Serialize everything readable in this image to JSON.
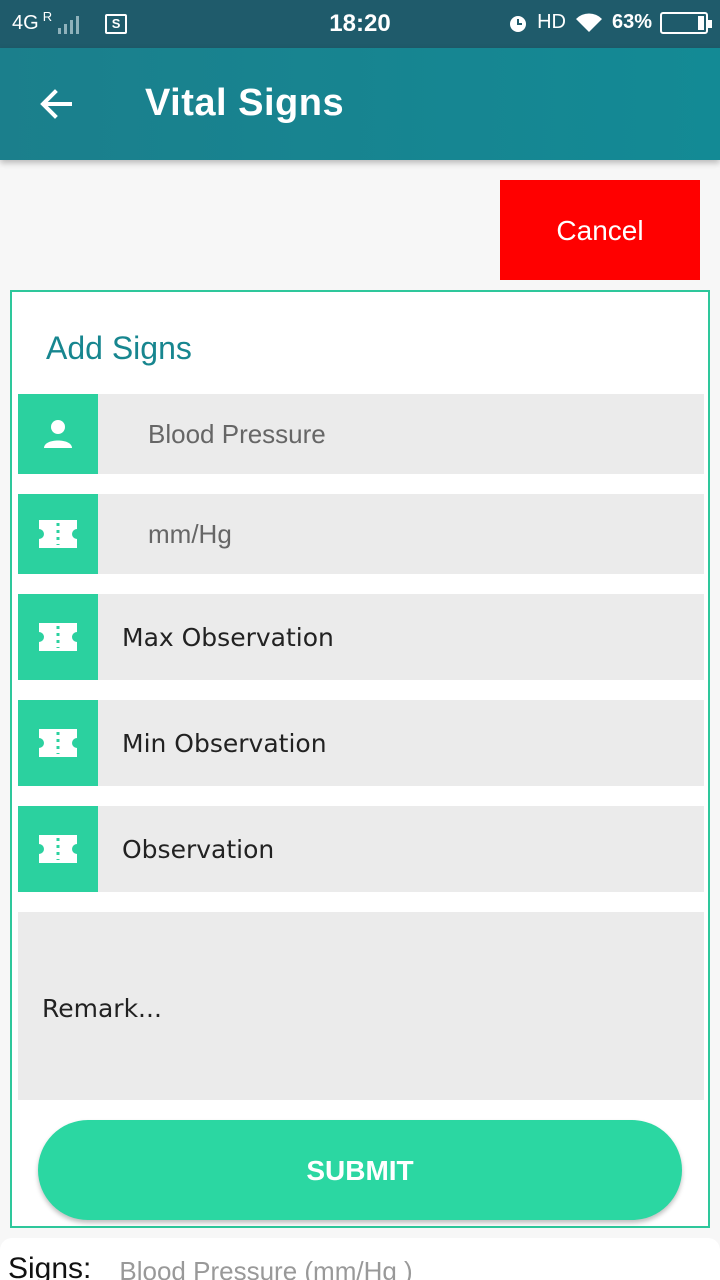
{
  "status_bar": {
    "network": "4G",
    "roaming": "R",
    "screenshot_icon": "S",
    "time": "18:20",
    "hd": "HD",
    "battery": "63%"
  },
  "app_bar": {
    "title": "Vital Signs",
    "back_icon": "arrow-left-icon"
  },
  "cancel_label": "Cancel",
  "form": {
    "title": "Add Signs",
    "sign_name": "Blood Pressure",
    "unit": "mm/Hg",
    "max_placeholder": "Max Observation",
    "min_placeholder": "Min Observation",
    "observation_placeholder": "Observation",
    "remark_placeholder": "Remark...",
    "submit_label": "SUBMIT"
  },
  "signs_summary": {
    "label": "Signs:",
    "value": "Blood Pressure (mm/Hg )"
  },
  "colors": {
    "app_bar": "#138a95",
    "accent": "#2bd19f",
    "cancel": "#ff0000",
    "field_bg": "#ebebeb"
  }
}
